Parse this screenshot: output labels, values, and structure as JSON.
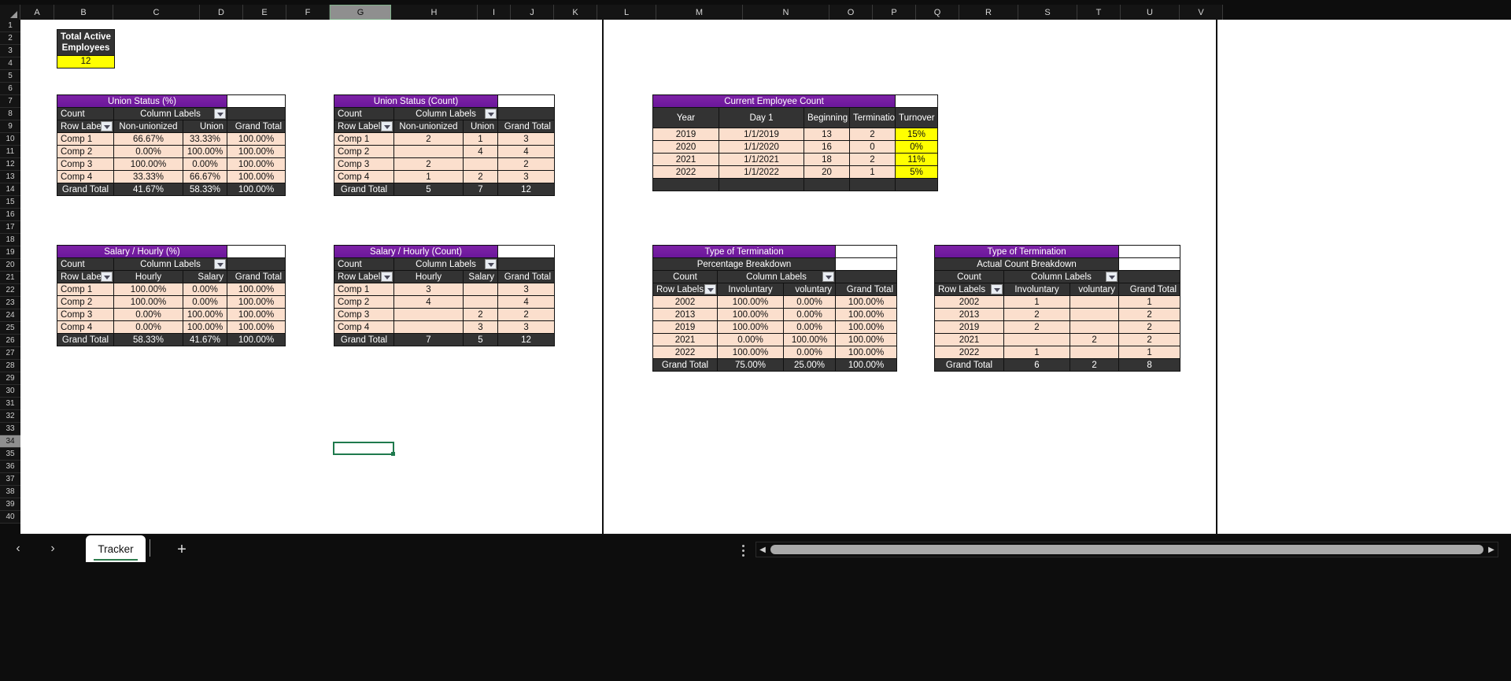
{
  "app": {
    "columns": [
      "A",
      "B",
      "C",
      "D",
      "E",
      "F",
      "G",
      "H",
      "I",
      "J",
      "K",
      "L",
      "M",
      "N",
      "O",
      "P",
      "Q",
      "R",
      "S",
      "T",
      "U",
      "V"
    ],
    "selected_column": "G",
    "selected_row": 34,
    "rows": [
      1,
      2,
      3,
      4,
      5,
      6,
      7,
      8,
      9,
      10,
      11,
      12,
      13,
      14,
      15,
      16,
      17,
      18,
      19,
      20,
      21,
      22,
      23,
      24,
      25,
      26,
      27,
      28,
      29,
      30,
      31,
      32,
      33,
      34,
      35,
      36,
      37,
      38,
      39,
      40
    ]
  },
  "sheet_tabs": {
    "prev_label": "‹",
    "next_label": "›",
    "active_tab": "Tracker",
    "add_label": "+",
    "scroll_left_label": "◀",
    "scroll_right_label": "▶"
  },
  "total_active_employees": {
    "title": "Total Active Employees",
    "value": "12"
  },
  "union_status_pct": {
    "title": "Union Status (%)",
    "count_label": "Count",
    "column_labels": "Column Labels",
    "row_labels": "Row Labels",
    "columns": [
      "Non-unionized",
      "Union",
      "Grand Total"
    ],
    "rows": [
      {
        "label": "Comp 1",
        "values": [
          "66.67%",
          "33.33%",
          "100.00%"
        ]
      },
      {
        "label": "Comp 2",
        "values": [
          "0.00%",
          "100.00%",
          "100.00%"
        ]
      },
      {
        "label": "Comp 3",
        "values": [
          "100.00%",
          "0.00%",
          "100.00%"
        ]
      },
      {
        "label": "Comp 4",
        "values": [
          "33.33%",
          "66.67%",
          "100.00%"
        ]
      }
    ],
    "grand_total": {
      "label": "Grand Total",
      "values": [
        "41.67%",
        "58.33%",
        "100.00%"
      ]
    }
  },
  "union_status_count": {
    "title": "Union Status (Count)",
    "count_label": "Count",
    "column_labels": "Column Labels",
    "row_labels": "Row Labels",
    "columns": [
      "Non-unionized",
      "Union",
      "Grand Total"
    ],
    "rows": [
      {
        "label": "Comp 1",
        "values": [
          "2",
          "1",
          "3"
        ]
      },
      {
        "label": "Comp 2",
        "values": [
          "",
          "4",
          "4"
        ]
      },
      {
        "label": "Comp 3",
        "values": [
          "2",
          "",
          "2"
        ]
      },
      {
        "label": "Comp 4",
        "values": [
          "1",
          "2",
          "3"
        ]
      }
    ],
    "grand_total": {
      "label": "Grand Total",
      "values": [
        "5",
        "7",
        "12"
      ]
    }
  },
  "salary_hourly_pct": {
    "title": "Salary / Hourly (%)",
    "count_label": "Count",
    "column_labels": "Column Labels",
    "row_labels": "Row Labels",
    "columns": [
      "Hourly",
      "Salary",
      "Grand Total"
    ],
    "rows": [
      {
        "label": "Comp 1",
        "values": [
          "100.00%",
          "0.00%",
          "100.00%"
        ]
      },
      {
        "label": "Comp 2",
        "values": [
          "100.00%",
          "0.00%",
          "100.00%"
        ]
      },
      {
        "label": "Comp 3",
        "values": [
          "0.00%",
          "100.00%",
          "100.00%"
        ]
      },
      {
        "label": "Comp 4",
        "values": [
          "0.00%",
          "100.00%",
          "100.00%"
        ]
      }
    ],
    "grand_total": {
      "label": "Grand Total",
      "values": [
        "58.33%",
        "41.67%",
        "100.00%"
      ]
    }
  },
  "salary_hourly_count": {
    "title": "Salary / Hourly (Count)",
    "count_label": "Count",
    "column_labels": "Column Labels",
    "row_labels": "Row Labels",
    "columns": [
      "Hourly",
      "Salary",
      "Grand Total"
    ],
    "rows": [
      {
        "label": "Comp 1",
        "values": [
          "3",
          "",
          "3"
        ]
      },
      {
        "label": "Comp 2",
        "values": [
          "4",
          "",
          "4"
        ]
      },
      {
        "label": "Comp 3",
        "values": [
          "",
          "2",
          "2"
        ]
      },
      {
        "label": "Comp 4",
        "values": [
          "",
          "3",
          "3"
        ]
      }
    ],
    "grand_total": {
      "label": "Grand Total",
      "values": [
        "7",
        "5",
        "12"
      ]
    }
  },
  "current_employee_count": {
    "title": "Current Employee Count",
    "columns": [
      "Year",
      "Day 1",
      "Beginning",
      "Terminations",
      "Turnover"
    ],
    "rows": [
      {
        "year": "2019",
        "day1": "1/1/2019",
        "beginning": "13",
        "terminations": "2",
        "turnover": "15%"
      },
      {
        "year": "2020",
        "day1": "1/1/2020",
        "beginning": "16",
        "terminations": "0",
        "turnover": "0%"
      },
      {
        "year": "2021",
        "day1": "1/1/2021",
        "beginning": "18",
        "terminations": "2",
        "turnover": "11%"
      },
      {
        "year": "2022",
        "day1": "1/1/2022",
        "beginning": "20",
        "terminations": "1",
        "turnover": "5%"
      }
    ]
  },
  "termination_pct": {
    "title": "Type of Termination",
    "subtitle": "Percentage Breakdown",
    "count_label": "Count",
    "column_labels": "Column Labels",
    "row_labels": "Row Labels",
    "columns": [
      "Involuntary",
      "voluntary",
      "Grand Total"
    ],
    "rows": [
      {
        "label": "2002",
        "values": [
          "100.00%",
          "0.00%",
          "100.00%"
        ]
      },
      {
        "label": "2013",
        "values": [
          "100.00%",
          "0.00%",
          "100.00%"
        ]
      },
      {
        "label": "2019",
        "values": [
          "100.00%",
          "0.00%",
          "100.00%"
        ]
      },
      {
        "label": "2021",
        "values": [
          "0.00%",
          "100.00%",
          "100.00%"
        ]
      },
      {
        "label": "2022",
        "values": [
          "100.00%",
          "0.00%",
          "100.00%"
        ]
      }
    ],
    "grand_total": {
      "label": "Grand Total",
      "values": [
        "75.00%",
        "25.00%",
        "100.00%"
      ]
    }
  },
  "termination_count": {
    "title": "Type of Termination",
    "subtitle": "Actual Count Breakdown",
    "count_label": "Count",
    "column_labels": "Column Labels",
    "row_labels": "Row Labels",
    "columns": [
      "Involuntary",
      "voluntary",
      "Grand Total"
    ],
    "rows": [
      {
        "label": "2002",
        "values": [
          "1",
          "",
          "1"
        ]
      },
      {
        "label": "2013",
        "values": [
          "2",
          "",
          "2"
        ]
      },
      {
        "label": "2019",
        "values": [
          "2",
          "",
          "2"
        ]
      },
      {
        "label": "2021",
        "values": [
          "",
          "2",
          "2"
        ]
      },
      {
        "label": "2022",
        "values": [
          "1",
          "",
          "1"
        ]
      }
    ],
    "grand_total": {
      "label": "Grand Total",
      "values": [
        "6",
        "2",
        "8"
      ]
    }
  },
  "colors": {
    "title_purple": "#7b1fa2",
    "header_dark": "#333333",
    "body_peach": "#fbdfcd",
    "highlight_yellow": "#ffff00",
    "tab_accent": "#2f7d4f"
  }
}
